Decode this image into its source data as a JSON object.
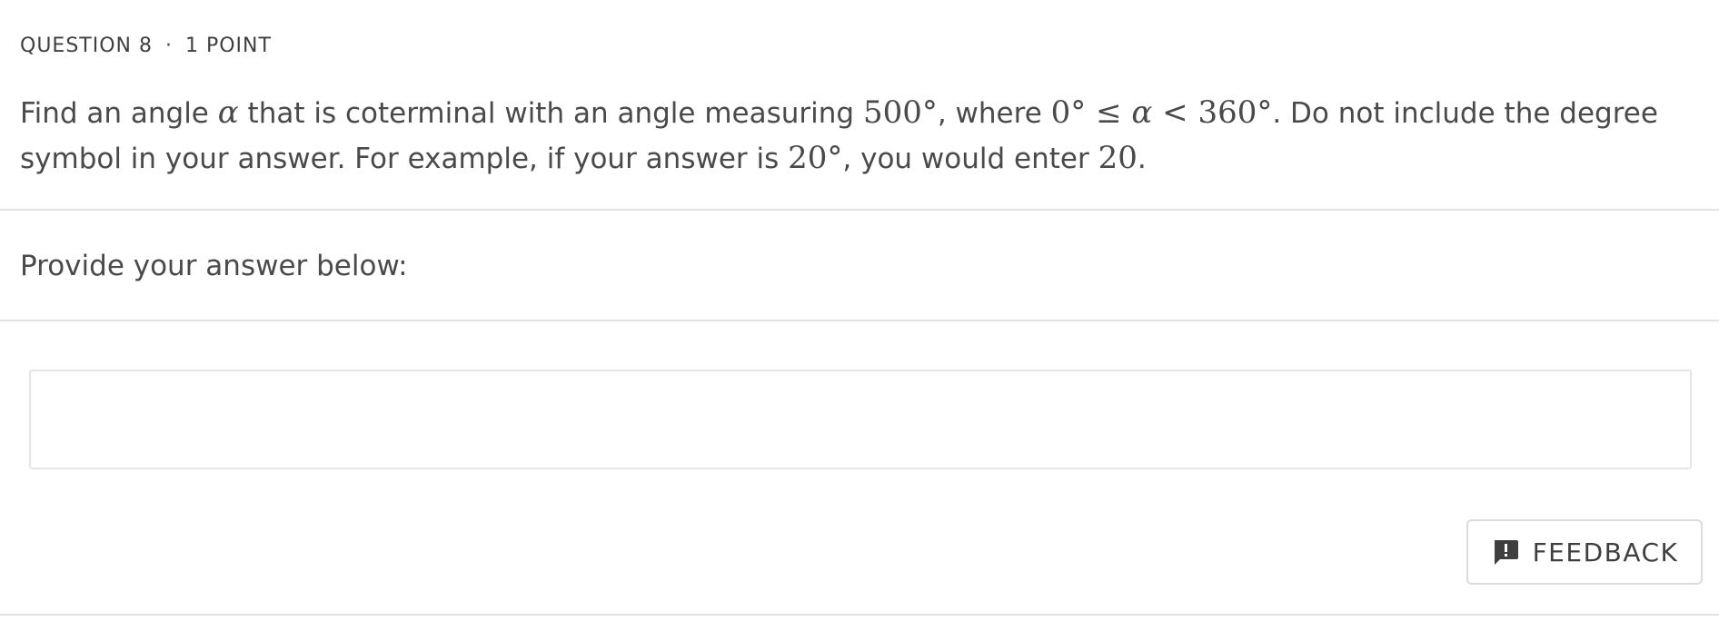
{
  "question": {
    "number_label": "QUESTION 8",
    "separator": "·",
    "points_label": "1 POINT",
    "prompt_parts": {
      "p1": "Find an angle ",
      "alpha": "α",
      "p2": " that is coterminal with an angle measuring ",
      "m_500": "500°",
      "p3": ", where ",
      "m_range_a": "0° ≤ ",
      "m_alpha2": "α",
      "m_range_b": " < 360°",
      "p4": ". Do not include the degree symbol in your answer. For example, if your answer is ",
      "m_20deg": "20°",
      "p5": ", you would enter ",
      "m_20": "20",
      "p6": "."
    }
  },
  "answer": {
    "instruction": "Provide your answer below:",
    "value": "",
    "placeholder": ""
  },
  "feedback_button": {
    "label": "FEEDBACK",
    "icon": "feedback-icon"
  }
}
